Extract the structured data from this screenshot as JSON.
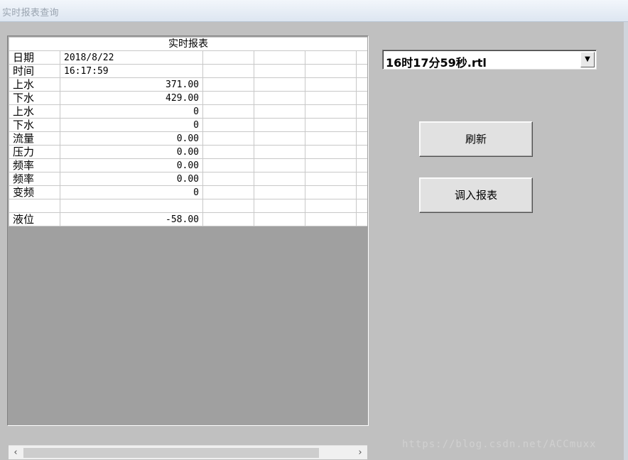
{
  "window": {
    "title": "实时报表查询"
  },
  "report": {
    "header": "实时报表",
    "rows": [
      {
        "label": "日期",
        "value": "2018/8/22"
      },
      {
        "label": "时间",
        "value": "16:17:59"
      },
      {
        "label": "上水",
        "value": "371.00"
      },
      {
        "label": "下水",
        "value": "429.00"
      },
      {
        "label": "上水",
        "value": "0"
      },
      {
        "label": "下水",
        "value": "0"
      },
      {
        "label": "流量",
        "value": "0.00"
      },
      {
        "label": "压力",
        "value": "0.00"
      },
      {
        "label": "频率",
        "value": "0.00"
      },
      {
        "label": "频率",
        "value": "0.00"
      },
      {
        "label": "变频",
        "value": "0"
      },
      {
        "label": "",
        "value": ""
      },
      {
        "label": "液位",
        "value": "-58.00"
      }
    ]
  },
  "file_select": {
    "selected": "16时17分59秒.rtl"
  },
  "buttons": {
    "refresh": "刷新",
    "load_report": "调入报表"
  },
  "watermark": "https://blog.csdn.net/ACCmuxx",
  "icons": {
    "scroll_left": "chevron-left-icon",
    "scroll_right": "chevron-right-icon",
    "dropdown": "caret-down-icon"
  }
}
